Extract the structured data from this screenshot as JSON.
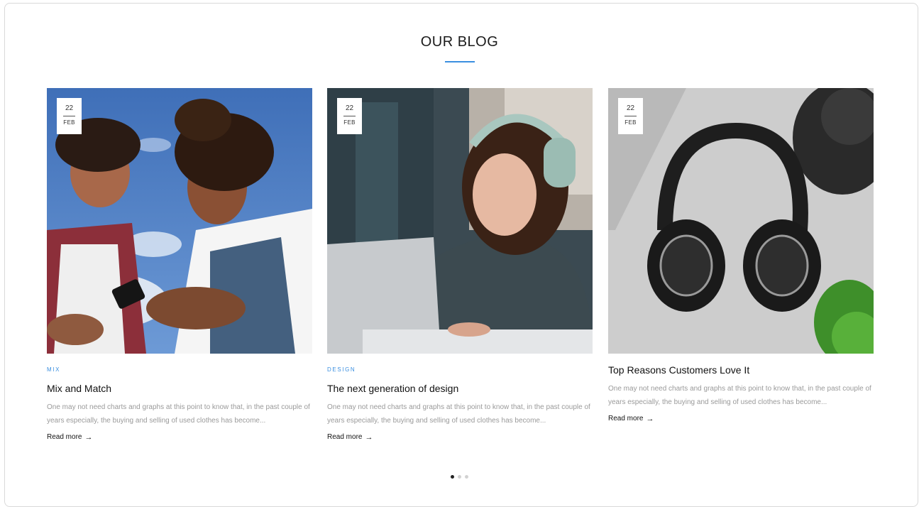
{
  "section": {
    "title": "OUR BLOG"
  },
  "accent_color": "#3b8fe0",
  "posts": [
    {
      "day": "22",
      "month": "FEB",
      "category": "MIX",
      "title": "Mix and Match",
      "excerpt": "One may not need charts and graphs at this point to know that, in the past couple of years especially, the buying and selling of used clothes has become...",
      "read_more": "Read more",
      "image": "two teens looking at a phone under blue sky"
    },
    {
      "day": "22",
      "month": "FEB",
      "category": "DESIGN",
      "title": "The next generation of design",
      "excerpt": "One may not need charts and graphs at this point to know that, in the past couple of years especially, the buying and selling of used clothes has become...",
      "read_more": "Read more",
      "image": "woman with headphones at laptop"
    },
    {
      "day": "22",
      "month": "FEB",
      "category": "",
      "title": "Top Reasons Customers Love It",
      "excerpt": "One may not need charts and graphs at this point to know that, in the past couple of years especially, the buying and selling of used clothes has become...",
      "read_more": "Read more",
      "image": "black headphones on grey desk"
    }
  ],
  "pagination": {
    "dots": 3,
    "active": 0
  },
  "icons": {
    "arrow": "arrow-right-icon"
  }
}
